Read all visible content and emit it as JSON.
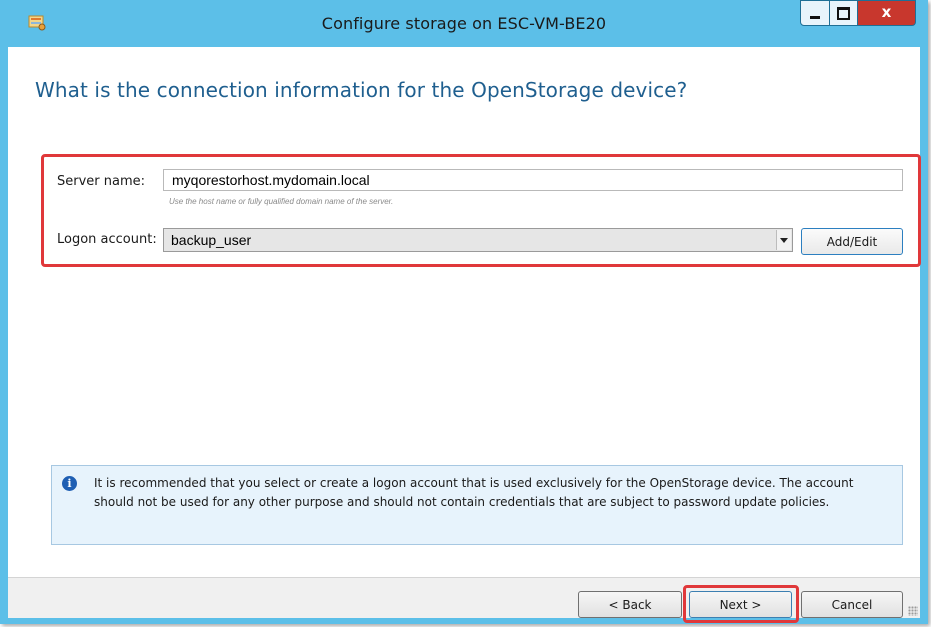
{
  "window": {
    "title": "Configure storage on ESC-VM-BE20",
    "icon": "storage-wizard-icon",
    "minimize": "minimize-icon",
    "maximize": "maximize-icon",
    "close_label": "x",
    "titlebar_color": "#5cbfe8",
    "close_color": "#c8372d"
  },
  "heading": "What is the connection information for the OpenStorage device?",
  "form": {
    "server_label": "Server name:",
    "server_value": "myqorestorhost.mydomain.local",
    "server_hint": "Use the host name or fully qualified domain name of the server.",
    "logon_label": "Logon account:",
    "logon_value": "backup_user",
    "add_edit_label": "Add/Edit"
  },
  "info": {
    "icon": "info-icon",
    "icon_glyph": "i",
    "text": "It is recommended that you select or create a logon account that is used exclusively for the OpenStorage device. The account should not be used for any other purpose and should not contain credentials that are subject to password update policies."
  },
  "footer": {
    "back_label": "< Back",
    "next_label": "Next >",
    "cancel_label": "Cancel"
  },
  "highlight_color": "#e0383a"
}
